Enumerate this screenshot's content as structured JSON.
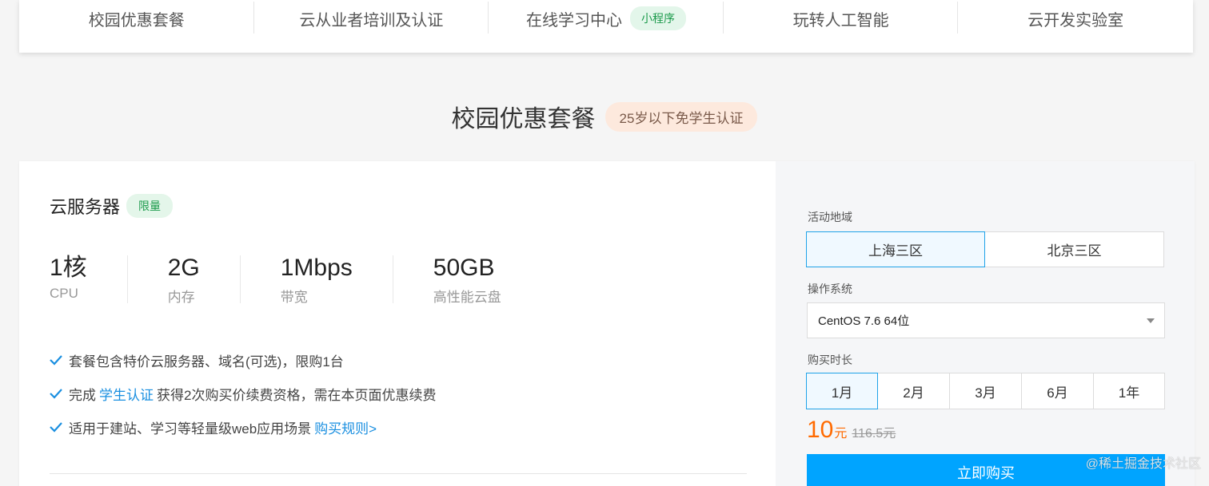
{
  "topnav": {
    "items": [
      {
        "label": "校园优惠套餐"
      },
      {
        "label": "云从业者培训及认证"
      },
      {
        "label": "在线学习中心",
        "badge": "小程序"
      },
      {
        "label": "玩转人工智能"
      },
      {
        "label": "云开发实验室"
      }
    ]
  },
  "section": {
    "title": "校园优惠套餐",
    "badge": "25岁以下免学生认证"
  },
  "product": {
    "name": "云服务器",
    "badge": "限量",
    "specs": [
      {
        "value": "1核",
        "label": "CPU"
      },
      {
        "value": "2G",
        "label": "内存"
      },
      {
        "value": "1Mbps",
        "label": "带宽"
      },
      {
        "value": "50GB",
        "label": "高性能云盘"
      }
    ],
    "features": {
      "f1": "套餐包含特价云服务器、域名(可选)，限购1台",
      "f2_pre": "完成",
      "f2_link": "学生认证",
      "f2_post": "获得2次购买价续费资格，需在本页面优惠续费",
      "f3_pre": "适用于建站、学习等轻量级web应用场景",
      "f3_link": "购买规则>"
    }
  },
  "order": {
    "region_label": "活动地域",
    "regions": [
      "上海三区",
      "北京三区"
    ],
    "region_selected": "上海三区",
    "os_label": "操作系统",
    "os_value": "CentOS 7.6 64位",
    "duration_label": "购买时长",
    "durations": [
      "1月",
      "2月",
      "3月",
      "6月",
      "1年"
    ],
    "duration_selected": "1月",
    "price": "10",
    "price_unit": "元",
    "price_old": "116.5元",
    "buy_label": "立即购买"
  },
  "watermark": "@稀土掘金技术社区",
  "colors": {
    "accent": "#00a4ff",
    "price": "#ff6a00",
    "success": "#1b9a4b"
  }
}
